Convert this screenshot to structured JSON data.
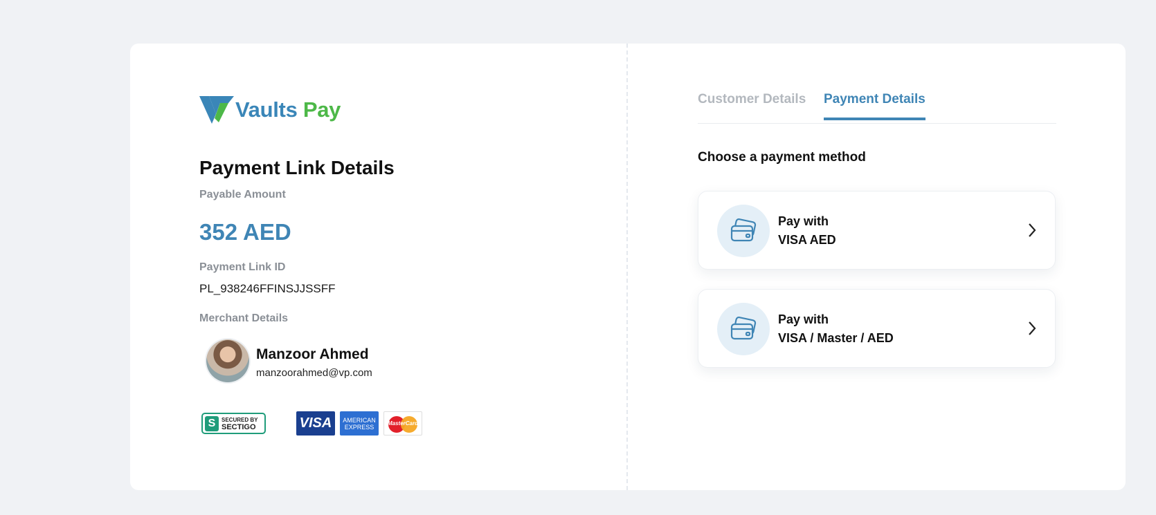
{
  "brand": {
    "name_part1": "Vaults",
    "name_part2": "Pay",
    "color_primary": "#3a86b8",
    "color_secondary": "#4db848"
  },
  "left": {
    "title": "Payment Link Details",
    "payable_label": "Payable Amount",
    "payable_amount": "352 AED",
    "link_id_label": "Payment Link ID",
    "link_id": "PL_938246FFINSJJSSFF",
    "merchant_label": "Merchant Details",
    "merchant": {
      "name": "Manzoor Ahmed",
      "email": "manzoorahmed@vp.com"
    },
    "badges": {
      "sectigo_line1": "SECURED BY",
      "sectigo_line2": "SECTIGO",
      "visa": "VISA",
      "amex_line1": "AMERICAN",
      "amex_line2": "EXPRESS",
      "mastercard": "MasterCard"
    }
  },
  "right": {
    "tabs": [
      {
        "label": "Customer Details",
        "active": false
      },
      {
        "label": "Payment Details",
        "active": true
      }
    ],
    "choose_label": "Choose a payment method",
    "methods": [
      {
        "line1": "Pay with",
        "line2": "VISA AED",
        "icon": "credit-card-icon"
      },
      {
        "line1": "Pay with",
        "line2": "VISA / Master / AED",
        "icon": "credit-card-icon"
      }
    ]
  }
}
